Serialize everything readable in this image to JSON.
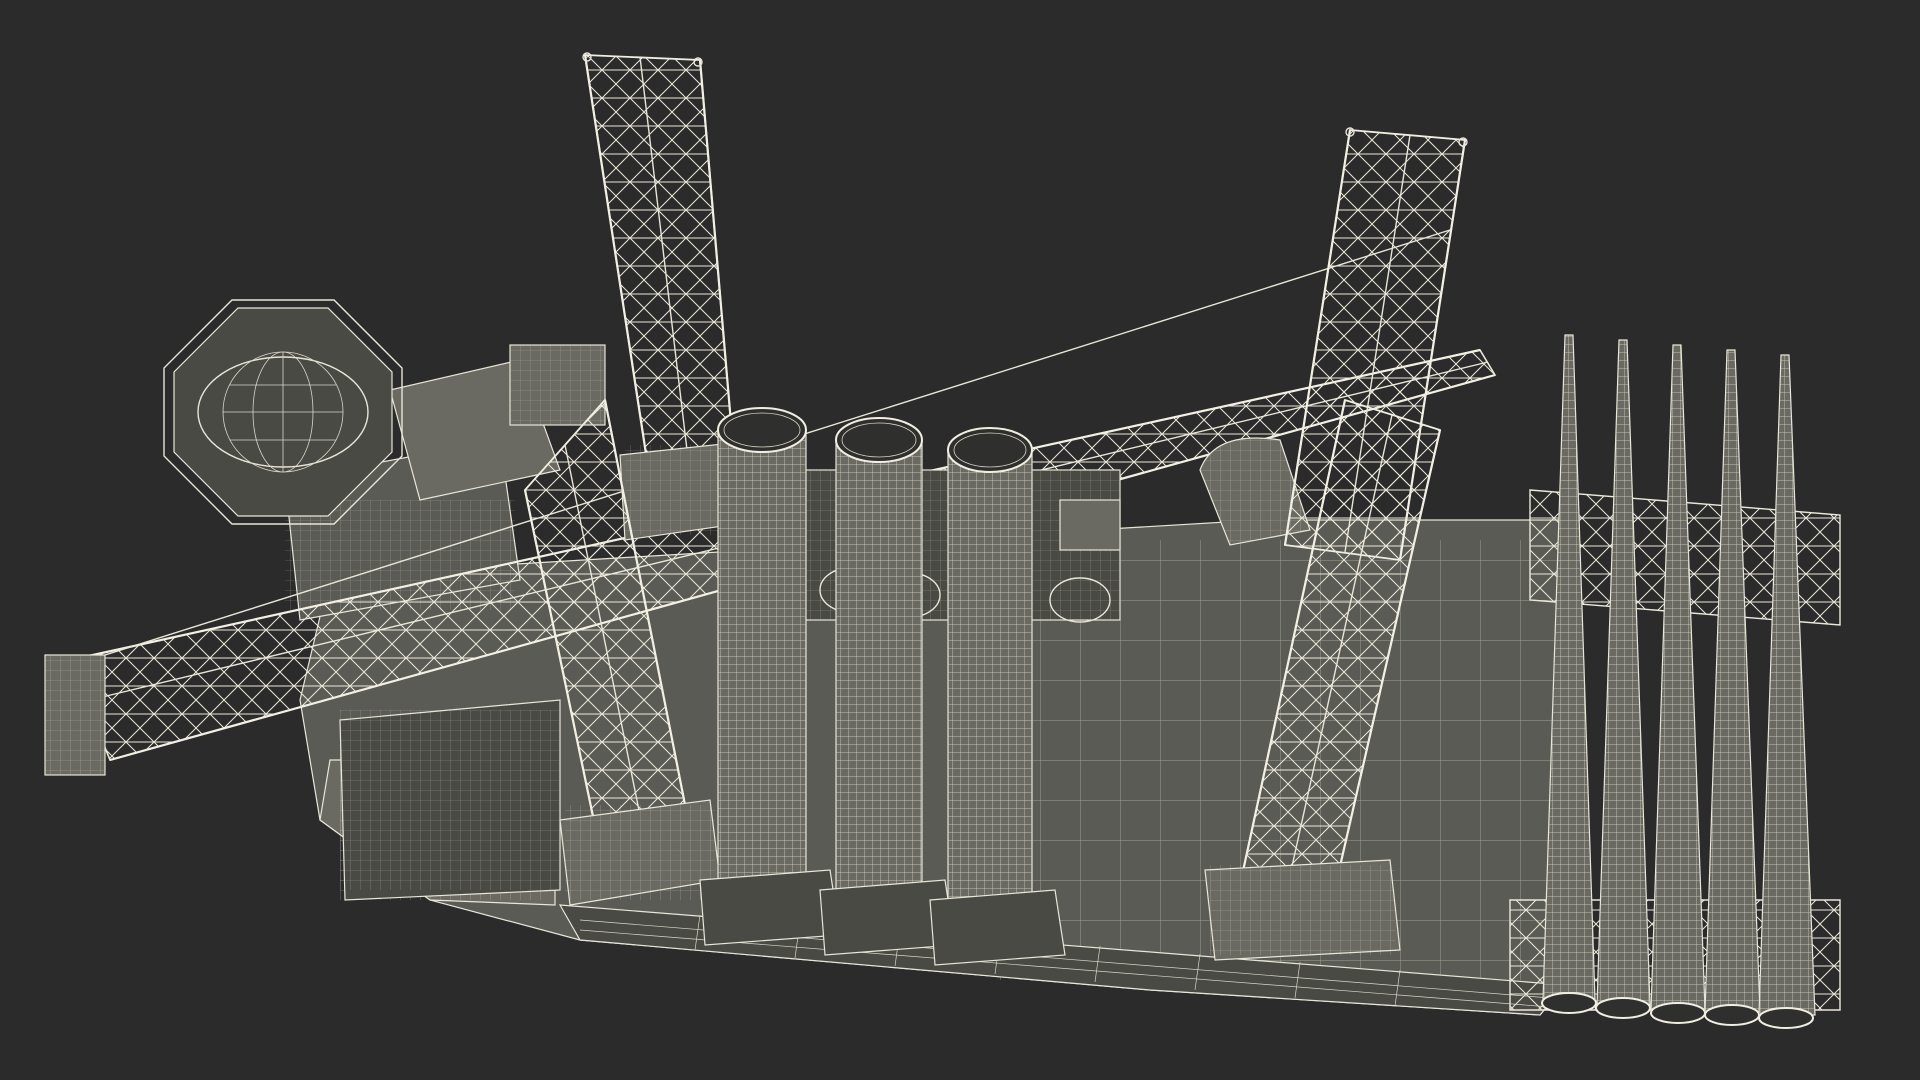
{
  "viewport": {
    "background_color": "#2b2b2b",
    "wire_color": "#e8e6d8",
    "surface_color": "#5b5b55"
  },
  "scene": {
    "legs": 4,
    "monopiles": 3,
    "transition_pieces": 5
  }
}
